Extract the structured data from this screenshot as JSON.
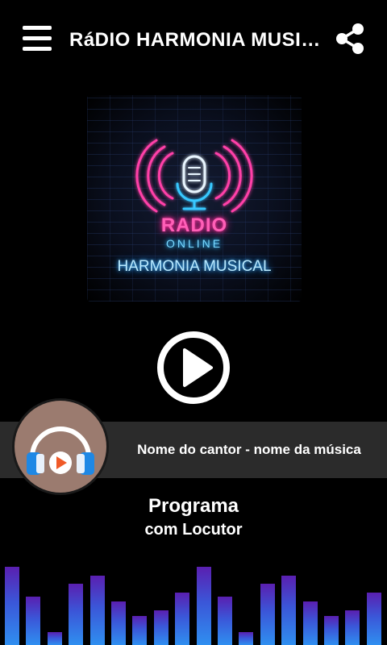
{
  "header": {
    "title": "RáDIO HARMONIA MUSICAL",
    "menu_icon": "hamburger-menu-icon",
    "share_icon": "share-icon"
  },
  "logo": {
    "radio_text": "RADIO",
    "online_text": "ONLINE",
    "station_text": "HARMONIA MUSICAL",
    "colors": {
      "pink": "#ff3fa8",
      "cyan": "#38c8ff"
    }
  },
  "player": {
    "play_icon": "play-icon",
    "now_playing": "Nome do cantor - nome da música",
    "avatar_icon": "headphones-play-icon"
  },
  "program": {
    "title": "Programa",
    "host": "com Locutor"
  },
  "equalizer": {
    "levels": [
      0.9,
      0.56,
      0.15,
      0.7,
      0.8,
      0.5,
      0.33,
      0.4,
      0.6,
      0.9,
      0.56,
      0.15,
      0.7,
      0.8,
      0.5,
      0.33,
      0.4,
      0.6
    ]
  }
}
